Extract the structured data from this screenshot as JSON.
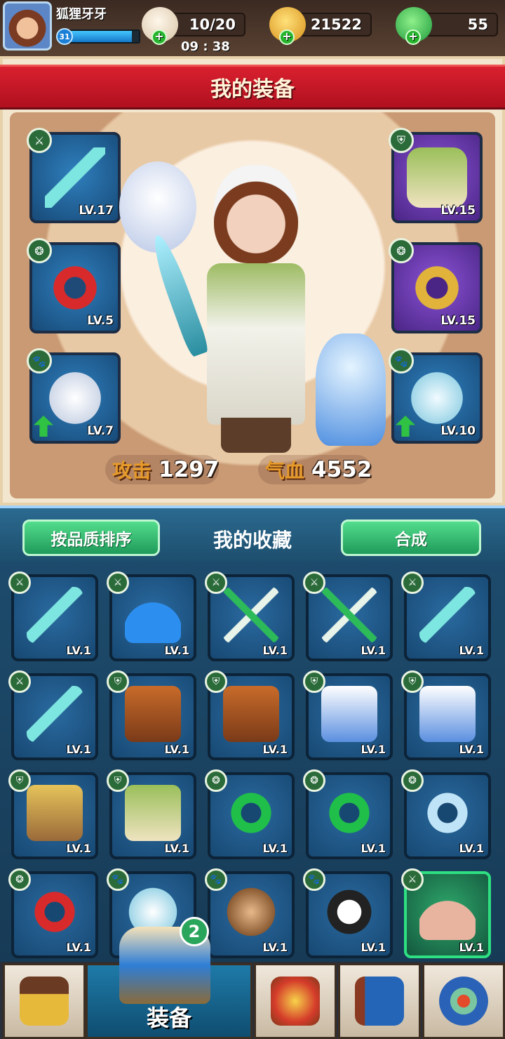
{
  "player": {
    "name": "狐狸牙牙",
    "level": "31",
    "exp_fraction": 0.9
  },
  "resources": {
    "stamina": {
      "value": "10/20",
      "icon": "bun-icon"
    },
    "timer": "09 : 38",
    "gold": {
      "value": "21522",
      "icon": "gold-leaf-icon"
    },
    "jade": {
      "value": "55",
      "icon": "jade-leaf-icon"
    }
  },
  "equipment_panel": {
    "title": "我的装备",
    "slots": [
      {
        "type_icon": "sword-icon",
        "type_glyph": "⚔",
        "item": "jade-sword",
        "level": "LV.17"
      },
      {
        "type_icon": "armor-icon",
        "type_glyph": "⛨",
        "item": "green-robe",
        "level": "LV.15"
      },
      {
        "type_icon": "pendant-icon",
        "type_glyph": "❂",
        "item": "red-jade-pendant",
        "level": "LV.5"
      },
      {
        "type_icon": "pendant-icon",
        "type_glyph": "❂",
        "item": "blue-gold-pendant",
        "level": "LV.15"
      },
      {
        "type_icon": "paw-icon",
        "type_glyph": "🐾",
        "item": "white-eagle",
        "level": "LV.7"
      },
      {
        "type_icon": "paw-icon",
        "type_glyph": "🐾",
        "item": "blue-ferret",
        "level": "LV.10"
      }
    ],
    "attack": {
      "label": "攻击",
      "value": "1297"
    },
    "hp": {
      "label": "气血",
      "value": "4552"
    }
  },
  "collection": {
    "sort_button": "按品质排序",
    "title": "我的收藏",
    "synth_button": "合成",
    "items": [
      {
        "type": "⚔",
        "name": "jade-sword",
        "level": "LV.1"
      },
      {
        "type": "⚔",
        "name": "blue-fan",
        "level": "LV.1"
      },
      {
        "type": "⚔",
        "name": "green-crossbow",
        "level": "LV.1"
      },
      {
        "type": "⚔",
        "name": "green-crossbow",
        "level": "LV.1"
      },
      {
        "type": "⚔",
        "name": "jade-sword",
        "level": "LV.1"
      },
      {
        "type": "⚔",
        "name": "jade-sword",
        "level": "LV.1"
      },
      {
        "type": "⛨",
        "name": "brown-armor",
        "level": "LV.1"
      },
      {
        "type": "⛨",
        "name": "brown-armor",
        "level": "LV.1"
      },
      {
        "type": "⛨",
        "name": "blue-fur-robe",
        "level": "LV.1"
      },
      {
        "type": "⛨",
        "name": "blue-fur-robe",
        "level": "LV.1"
      },
      {
        "type": "⛨",
        "name": "gold-armor",
        "level": "LV.1"
      },
      {
        "type": "⛨",
        "name": "green-robe",
        "level": "LV.1"
      },
      {
        "type": "❂",
        "name": "green-jade-pendant",
        "level": "LV.1"
      },
      {
        "type": "❂",
        "name": "green-jade-pendant",
        "level": "LV.1"
      },
      {
        "type": "❂",
        "name": "blue-jade-pendant",
        "level": "LV.1"
      },
      {
        "type": "❂",
        "name": "red-jade-pendant",
        "level": "LV.1"
      },
      {
        "type": "🐾",
        "name": "white-ferret",
        "level": "LV.1"
      },
      {
        "type": "🐾",
        "name": "monkey",
        "level": "LV.1"
      },
      {
        "type": "🐾",
        "name": "panda",
        "level": "LV.1"
      },
      {
        "type": "⚔",
        "name": "mountain-fan",
        "level": "LV.1",
        "selected": true
      }
    ]
  },
  "bottom_nav": {
    "active_label": "装备",
    "badge_count": "2",
    "items": [
      "shop-icon",
      "equipment-icon",
      "skill-icon",
      "book-icon",
      "settings-gear-icon"
    ]
  }
}
